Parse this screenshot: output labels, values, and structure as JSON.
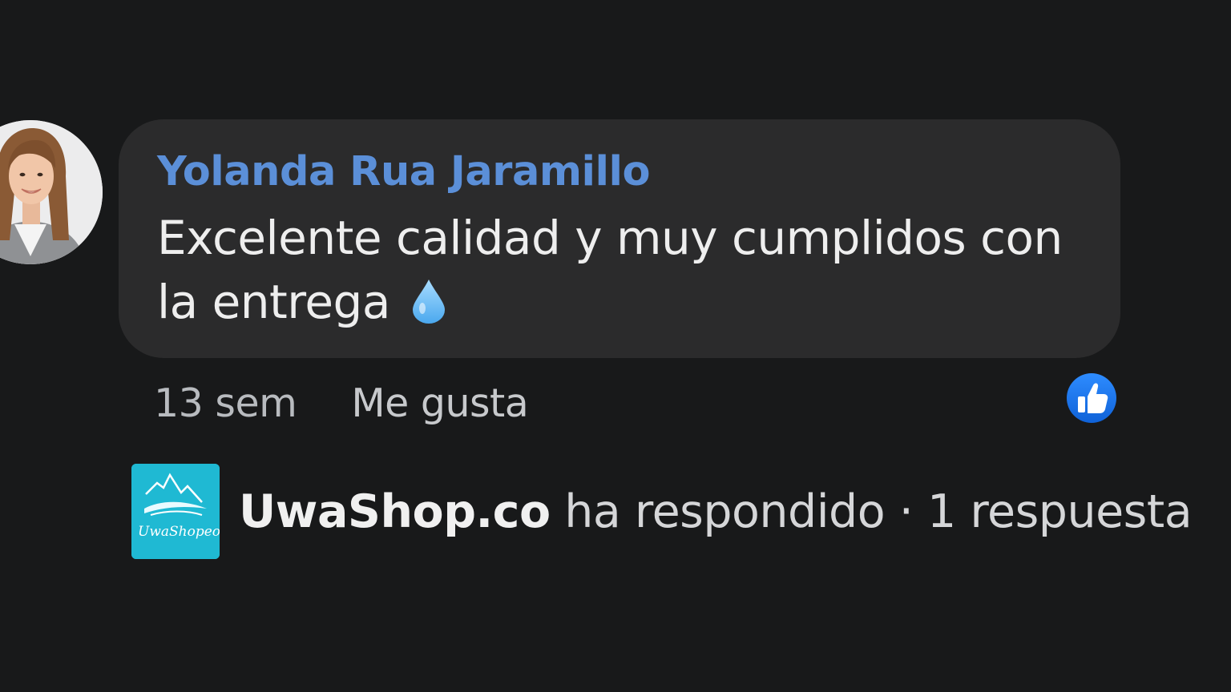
{
  "comment": {
    "author": "Yolanda Rua Jaramillo",
    "text": "Excelente calidad y muy cumplidos con la entrega",
    "emoji_icon": "droplet-icon",
    "time": "13 sem",
    "like_label": "Me gusta",
    "reaction_icon": "thumbs-up-icon"
  },
  "reply": {
    "page_name": "UwaShop.co",
    "status_text": " ha respondido · 1 respuesta",
    "logo_text": "UwaShopeo"
  },
  "colors": {
    "background": "#18191a",
    "bubble": "#2b2b2c",
    "author_link": "#5b8fd8",
    "reaction_blue": "#1877f2",
    "logo_teal": "#1fb9d3"
  }
}
